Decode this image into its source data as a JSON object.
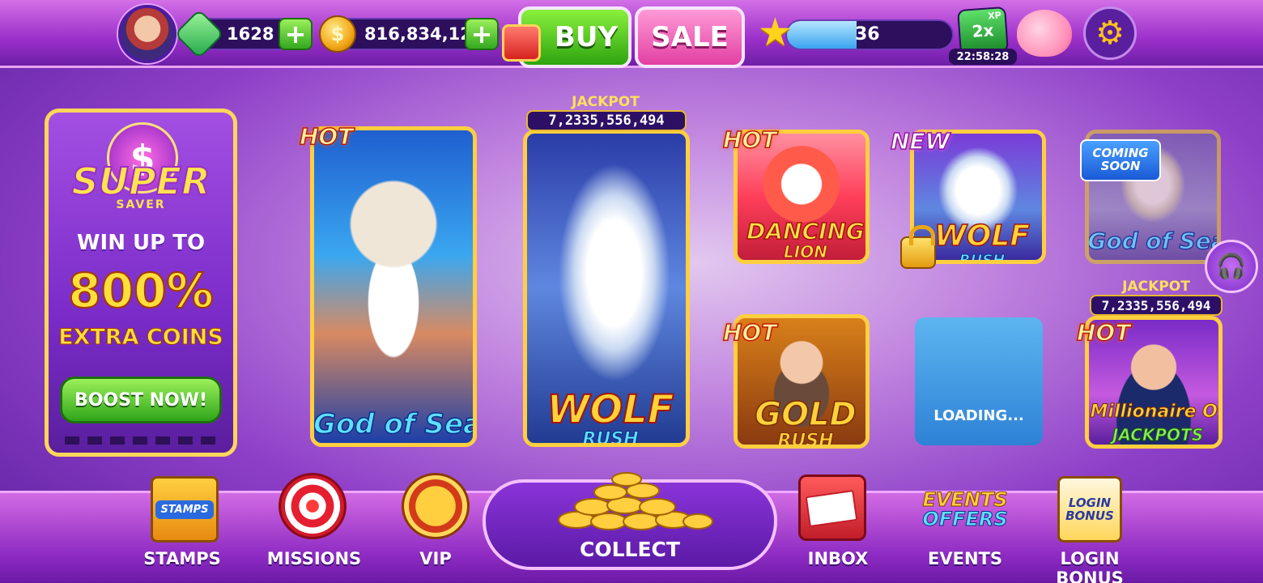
{
  "top_bar": {
    "gems": "1628",
    "coins": "816,834,12",
    "buy_label": "BUY",
    "sale_label": "SALE",
    "level": "36",
    "level_progress": 0.42,
    "xp_boost": "2x",
    "xp_boost_sub": "XP",
    "xp_timer": "22:58:28"
  },
  "promo": {
    "title": "SUPER",
    "subtitle": "SAVER",
    "line1": "WIN UP TO",
    "line2": "800%",
    "line3": "EXTRA COINS",
    "button": "BOOST NOW!"
  },
  "games": [
    {
      "title": "God of Sea",
      "badge": "HOT"
    },
    {
      "title_top": "WOLF",
      "title_bottom": "RUSH",
      "jackpot_label": "JACKPOT",
      "jackpot_value": "7,2335,556,494"
    },
    {
      "title_top": "DANCING",
      "title_bottom": "LION",
      "badge": "HOT"
    },
    {
      "title_top": "WOLF",
      "title_bottom": "RUSH",
      "badge": "NEW"
    },
    {
      "title": "God of Sea",
      "badge": "COMING SOON"
    },
    {
      "title_top": "GOLD",
      "title_bottom": "RUSH",
      "badge": "HOT"
    },
    {
      "loading_label": "LOADING..."
    },
    {
      "title_top": "Millionaire Of",
      "title_bottom": "JACKPOTS",
      "badge": "HOT",
      "jackpot_label": "JACKPOT",
      "jackpot_value": "7,2335,556,494"
    }
  ],
  "bottom_nav": {
    "stamps": "STAMPS",
    "stamps_icon_text": "STAMPS",
    "missions": "MISSIONS",
    "vip": "VIP",
    "collect": "COLLECT",
    "inbox": "INBOX",
    "events": "EVENTS",
    "events_icon_text1": "EVENTS",
    "events_icon_text2": "OFFERS",
    "login_bonus": "LOGIN BONUS",
    "login_icon_text1": "LOGIN",
    "login_icon_text2": "BONUS"
  },
  "colors": {
    "gold_border": "#ffcf3f",
    "purple_bg": "#8e3fc8",
    "buy_green": "#2ea40f",
    "sale_pink": "#e23fa3"
  },
  "icons": [
    "avatar",
    "gem-icon",
    "coin-icon",
    "plus-icon",
    "gift-icon",
    "star-icon",
    "xp-boost-icon",
    "piggy-bank-icon",
    "gear-icon",
    "support-icon",
    "lock-icon",
    "stamps-icon",
    "missions-target-icon",
    "vip-lion-icon",
    "coin-pile-icon",
    "inbox-mailbox-icon",
    "events-offers-icon",
    "login-bonus-calendar-icon"
  ]
}
